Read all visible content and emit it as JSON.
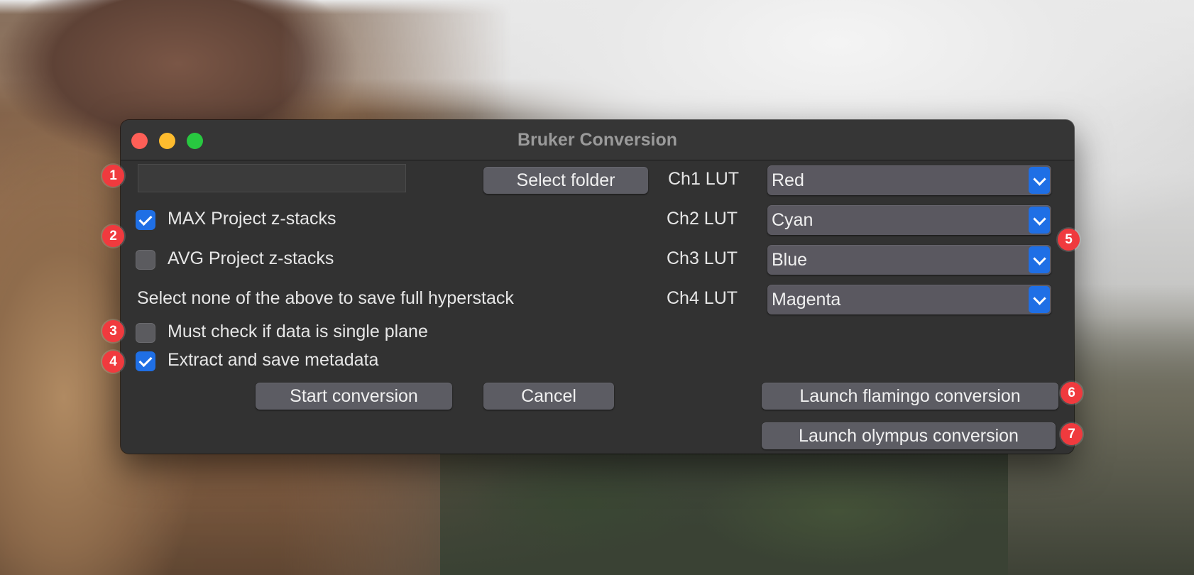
{
  "window": {
    "title": "Bruker Conversion"
  },
  "folder": {
    "path_value": "",
    "select_button": "Select folder"
  },
  "options": {
    "max_project": {
      "label": "MAX Project z-stacks",
      "checked": true
    },
    "avg_project": {
      "label": "AVG Project z-stacks",
      "checked": false
    },
    "hint": "Select none of the above to save full hyperstack",
    "single_plane": {
      "label": "Must check if data is single plane",
      "checked": false
    },
    "metadata": {
      "label": "Extract and save metadata",
      "checked": true
    }
  },
  "luts": [
    {
      "label": "Ch1 LUT",
      "value": "Red"
    },
    {
      "label": "Ch2 LUT",
      "value": "Cyan"
    },
    {
      "label": "Ch3 LUT",
      "value": "Blue"
    },
    {
      "label": "Ch4 LUT",
      "value": "Magenta"
    }
  ],
  "actions": {
    "start": "Start conversion",
    "cancel": "Cancel",
    "flamingo": "Launch flamingo conversion",
    "olympus": "Launch olympus conversion"
  },
  "annotations": [
    "1",
    "2",
    "3",
    "4",
    "5",
    "6",
    "7"
  ],
  "colors": {
    "accent": "#1f6fe5",
    "badge": "#f03a3e",
    "window_bg": "#323232"
  }
}
